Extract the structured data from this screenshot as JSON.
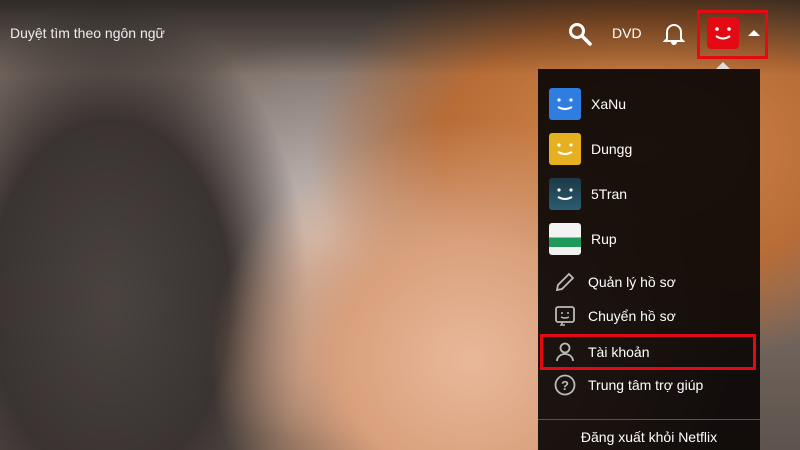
{
  "header": {
    "browse_label": "Duyệt tìm theo ngôn ngữ",
    "dvd_label": "DVD"
  },
  "menu": {
    "profiles": [
      {
        "name": "XaNu",
        "color": "#2f7de1"
      },
      {
        "name": "Dungg",
        "color": "#e6b020"
      },
      {
        "name": "5Tran",
        "color": "#1f4a5e"
      },
      {
        "name": "Rup",
        "color": "#e8e8e8"
      }
    ],
    "actions": [
      {
        "label": "Quản lý hồ sơ",
        "icon": "pencil-icon"
      },
      {
        "label": "Chuyển hồ sơ",
        "icon": "switch-profile-icon"
      },
      {
        "label": "Tài khoản",
        "icon": "person-icon"
      },
      {
        "label": "Trung tâm trợ giúp",
        "icon": "help-icon"
      }
    ],
    "logout_label": "Đăng xuất khỏi Netflix"
  },
  "colors": {
    "accent": "#e50914"
  }
}
